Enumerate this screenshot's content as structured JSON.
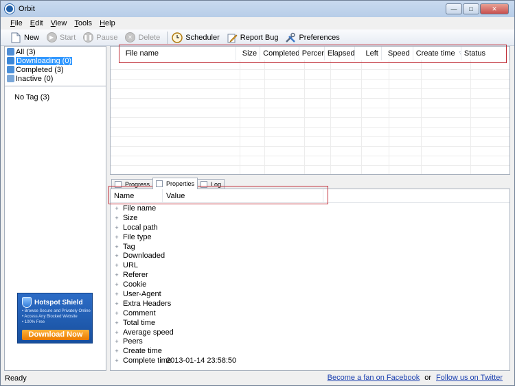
{
  "window": {
    "title": "Orbit"
  },
  "menu": [
    {
      "label": "File",
      "key": "F"
    },
    {
      "label": "Edit",
      "key": "E"
    },
    {
      "label": "View",
      "key": "V"
    },
    {
      "label": "Tools",
      "key": "T"
    },
    {
      "label": "Help",
      "key": "H"
    }
  ],
  "toolbar": {
    "new": "New",
    "start": "Start",
    "pause": "Pause",
    "delete": "Delete",
    "scheduler": "Scheduler",
    "report_bug": "Report Bug",
    "preferences": "Preferences"
  },
  "sidebar": {
    "filters": [
      {
        "label": "All (3)",
        "icon": "grid-icon",
        "color": "#4f8ed6"
      },
      {
        "label": "Downloading (0)",
        "icon": "download-arrow-icon",
        "color": "#3b87d8",
        "selected": true
      },
      {
        "label": "Completed (3)",
        "icon": "completed-icon",
        "color": "#4a8fd8"
      },
      {
        "label": "Inactive (0)",
        "icon": "inactive-icon",
        "color": "#7aa7d8"
      }
    ],
    "tag": "No Tag (3)"
  },
  "ad": {
    "title": "Hotspot Shield",
    "lines": [
      "• Browse Secure and Privately Online",
      "• Access Any Blocked Website",
      "• 100% Free"
    ],
    "cta": "Download Now"
  },
  "file_list": {
    "columns": [
      "File name",
      "Size",
      "Completed",
      "Percent",
      "Elapsed",
      "Left",
      "Speed",
      "Create time",
      "Status"
    ]
  },
  "tabs": [
    {
      "label": "Progress",
      "active": false
    },
    {
      "label": "Properties",
      "active": true
    },
    {
      "label": "Log",
      "active": false
    }
  ],
  "properties": {
    "columns": [
      "Name",
      "Value"
    ],
    "rows": [
      {
        "name": "File name",
        "value": ""
      },
      {
        "name": "Size",
        "value": ""
      },
      {
        "name": "Local path",
        "value": ""
      },
      {
        "name": "File type",
        "value": ""
      },
      {
        "name": "Tag",
        "value": ""
      },
      {
        "name": "Downloaded",
        "value": ""
      },
      {
        "name": "URL",
        "value": ""
      },
      {
        "name": "Referer",
        "value": ""
      },
      {
        "name": "Cookie",
        "value": ""
      },
      {
        "name": "User-Agent",
        "value": ""
      },
      {
        "name": "Extra Headers",
        "value": ""
      },
      {
        "name": "Comment",
        "value": ""
      },
      {
        "name": "Total time",
        "value": ""
      },
      {
        "name": "Average speed",
        "value": ""
      },
      {
        "name": "Peers",
        "value": ""
      },
      {
        "name": "Create time",
        "value": ""
      },
      {
        "name": "Complete time",
        "value": "2013-01-14 23:58:50"
      }
    ]
  },
  "status": {
    "text": "Ready",
    "facebook": "Become a fan on Facebook",
    "or": "or",
    "twitter": "Follow us on Twitter"
  },
  "colors": {
    "highlight_box": "#c0303a",
    "selection": "#3399ff",
    "link": "#1a3fb0"
  }
}
